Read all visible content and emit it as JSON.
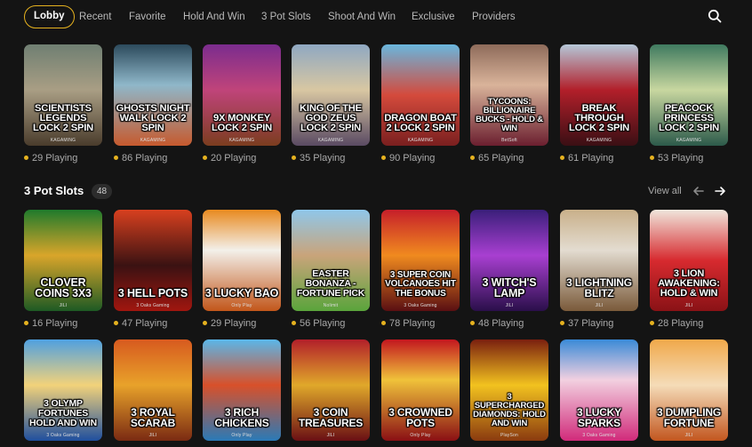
{
  "nav": {
    "tabs": [
      "Lobby",
      "Recent",
      "Favorite",
      "Hold And Win",
      "3 Pot Slots",
      "Shoot And Win",
      "Exclusive",
      "Providers"
    ],
    "active": "Lobby"
  },
  "icons": {
    "search": "search-icon",
    "prev": "arrow-left-icon",
    "next": "arrow-right-icon",
    "status_dot": "status-dot-icon"
  },
  "colors": {
    "accent": "#e6b21f",
    "background": "#141414"
  },
  "section": {
    "title": "3 Pot Slots",
    "count": "48",
    "view_all": "View all"
  },
  "row1": [
    {
      "title": "Scientists Legends Lock 2 Spin",
      "provider": "KAGAMING",
      "playing": "29 Playing"
    },
    {
      "title": "Ghosts Night Walk Lock 2 Spin",
      "provider": "KAGAMING",
      "playing": "86 Playing"
    },
    {
      "title": "9X Monkey Lock 2 Spin",
      "provider": "KAGAMING",
      "playing": "20 Playing"
    },
    {
      "title": "King of the God Zeus Lock 2 Spin",
      "provider": "KAGAMING",
      "playing": "35 Playing"
    },
    {
      "title": "Dragon Boat 2 Lock 2 Spin",
      "provider": "KAGAMING",
      "playing": "90 Playing"
    },
    {
      "title": "Tycoons: Billionaire Bucks - Hold & Win",
      "provider": "BetSoft",
      "playing": "65 Playing"
    },
    {
      "title": "Break Through Lock 2 Spin",
      "provider": "KAGAMING",
      "playing": "61 Playing"
    },
    {
      "title": "Peacock Princess Lock 2 Spin",
      "provider": "KAGAMING",
      "playing": "53 Playing"
    }
  ],
  "row2": [
    {
      "title": "Clover Coins 3x3",
      "provider": "JILI",
      "playing": "16 Playing"
    },
    {
      "title": "3 Hell Pots",
      "provider": "3 Oaks Gaming",
      "playing": "47 Playing"
    },
    {
      "title": "3 Lucky Bao",
      "provider": "Only Play",
      "playing": "29 Playing"
    },
    {
      "title": "Easter Bonanza - Fortune Pick",
      "provider": "Nolimit",
      "playing": "56 Playing"
    },
    {
      "title": "3 Super Coin Volcanoes Hit the Bonus",
      "provider": "3 Oaks Gaming",
      "playing": "78 Playing"
    },
    {
      "title": "3 Witch's Lamp",
      "provider": "JILI",
      "playing": "48 Playing"
    },
    {
      "title": "3 Lightning Blitz",
      "provider": "JILI",
      "playing": "37 Playing"
    },
    {
      "title": "3 Lion Awakening: Hold & Win",
      "provider": "JILI",
      "playing": "28 Playing"
    }
  ],
  "row3": [
    {
      "title": "3 Olymp Fortunes Hold and Win",
      "provider": "3 Oaks Gaming",
      "playing": ""
    },
    {
      "title": "3 Royal Scarab",
      "provider": "JILI",
      "playing": ""
    },
    {
      "title": "3 Rich Chickens",
      "provider": "Only Play",
      "playing": ""
    },
    {
      "title": "3 Coin Treasures",
      "provider": "JILI",
      "playing": ""
    },
    {
      "title": "3 Crowned Pots",
      "provider": "Only Play",
      "playing": ""
    },
    {
      "title": "3 Supercharged Diamonds: Hold and Win",
      "provider": "PlaySon",
      "playing": ""
    },
    {
      "title": "3 Lucky Sparks",
      "provider": "3 Oaks Gaming",
      "playing": ""
    },
    {
      "title": "3 Dumpling Fortune",
      "provider": "JILI",
      "playing": ""
    }
  ]
}
